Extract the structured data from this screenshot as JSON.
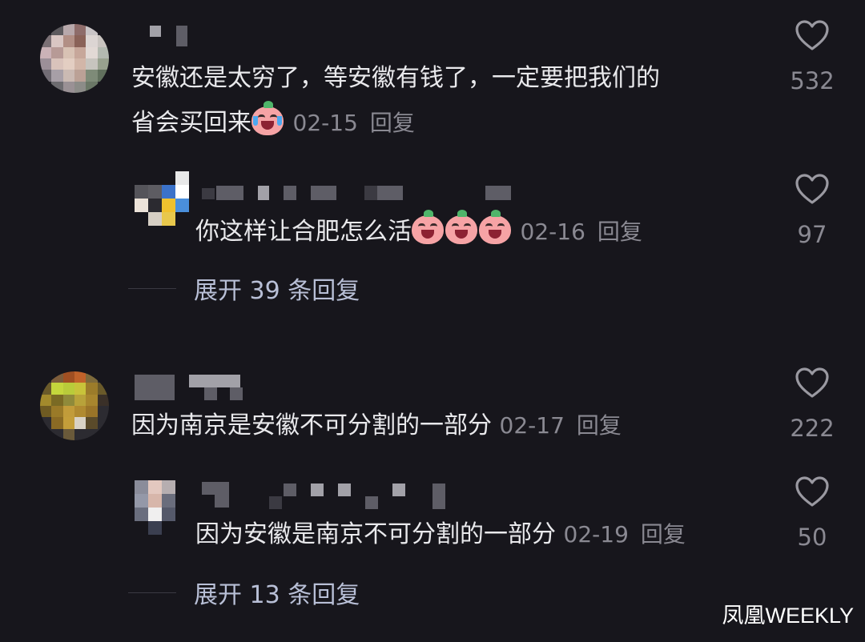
{
  "colors": {
    "background": "#17161c",
    "text": "#e9e9ec",
    "meta": "#8a8992",
    "expand": "#b8bfd6"
  },
  "comments": [
    {
      "text_line1": "安徽还是太穷了，等安徽有钱了，一定要把我们的",
      "text_line2": "省会买回来",
      "emoji": "crying-face-icon",
      "date": "02-15",
      "reply_label": "回复",
      "likes": "532",
      "replies": [
        {
          "text": "你这样让合肥怎么活",
          "emoji": "laughing-face-icon",
          "emoji_count": 3,
          "date": "02-16",
          "reply_label": "回复",
          "likes": "97"
        }
      ],
      "expand_label": "展开 39 条回复"
    },
    {
      "text_line1": "因为南京是安徽不可分割的一部分",
      "date": "02-17",
      "reply_label": "回复",
      "likes": "222",
      "replies": [
        {
          "text": "因为安徽是南京不可分割的一部分",
          "date": "02-19",
          "reply_label": "回复",
          "likes": "50"
        }
      ],
      "expand_label": "展开 13 条回复"
    }
  ],
  "watermark": "凤凰WEEKLY"
}
